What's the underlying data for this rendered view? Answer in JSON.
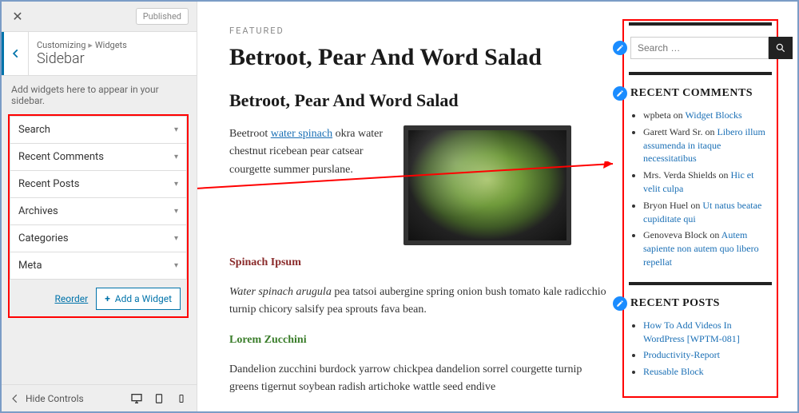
{
  "customizer": {
    "published": "Published",
    "crumb_root": "Customizing",
    "crumb_section": "Widgets",
    "title": "Sidebar",
    "hint": "Add widgets here to appear in your sidebar.",
    "items": [
      {
        "label": "Search"
      },
      {
        "label": "Recent Comments"
      },
      {
        "label": "Recent Posts"
      },
      {
        "label": "Archives"
      },
      {
        "label": "Categories"
      },
      {
        "label": "Meta"
      }
    ],
    "reorder": "Reorder",
    "add_widget": "Add a Widget",
    "hide_controls": "Hide Controls"
  },
  "post": {
    "featured": "FEATURED",
    "title": "Betroot, Pear And Word Salad",
    "subtitle": "Betroot, Pear And Word Salad",
    "intro_before": "Beetroot ",
    "intro_link": "water spinach",
    "intro_after": " okra water chestnut ricebean pear catsear courgette summer purslane.",
    "h_spinach": "Spinach Ipsum",
    "p_spinach_em": "Water spinach arugula",
    "p_spinach_rest": " pea tatsoi aubergine spring onion bush tomato kale radicchio turnip chicory salsify pea sprouts fava bean.",
    "h_lorem": "Lorem Zucchini",
    "p_lorem": "Dandelion zucchini burdock yarrow chickpea dandelion sorrel courgette turnip greens tigernut soybean radish artichoke wattle seed endive"
  },
  "sidebar": {
    "search_placeholder": "Search …",
    "recent_comments_title": "RECENT COMMENTS",
    "comments": [
      {
        "author": "wpbeta",
        "on": " on ",
        "post": "Widget Blocks"
      },
      {
        "author": "Garett Ward Sr.",
        "on": " on ",
        "post": "Libero illum assumenda in itaque necessitatibus"
      },
      {
        "author": "Mrs. Verda Shields",
        "on": " on ",
        "post": "Hic et velit culpa"
      },
      {
        "author": "Bryon Huel",
        "on": " on ",
        "post": "Ut natus beatae cupiditate qui"
      },
      {
        "author": "Genoveva Block",
        "on": " on ",
        "post": "Autem sapiente non autem quo libero repellat"
      }
    ],
    "recent_posts_title": "RECENT POSTS",
    "posts": [
      {
        "title": "How To Add Videos In WordPress [WPTM-081]"
      },
      {
        "title": "Productivity-Report"
      },
      {
        "title": "Reusable Block"
      }
    ]
  }
}
